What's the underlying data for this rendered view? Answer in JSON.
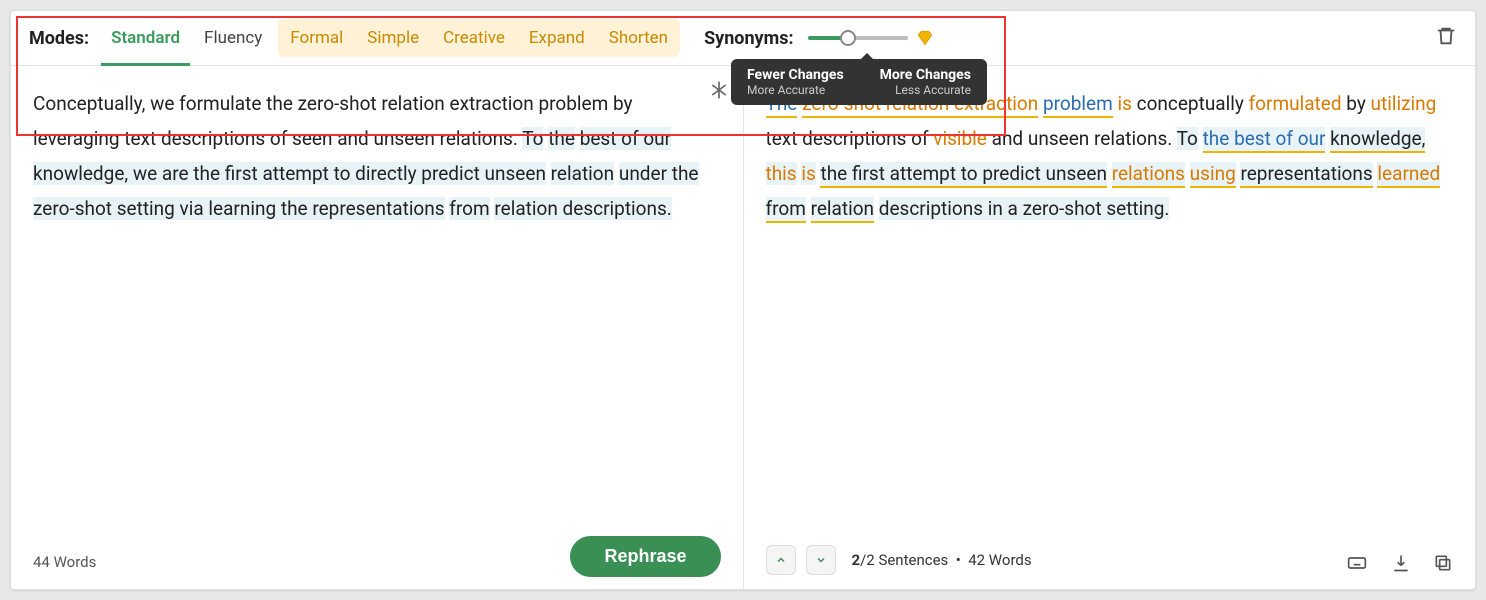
{
  "toolbar": {
    "modes_label": "Modes:",
    "tabs": {
      "standard": "Standard",
      "fluency": "Fluency",
      "formal": "Formal",
      "simple": "Simple",
      "creative": "Creative",
      "expand": "Expand",
      "shorten": "Shorten"
    },
    "active_tab": "standard",
    "synonyms_label": "Synonyms:",
    "slider_value_pct": 40
  },
  "tooltip": {
    "left_title": "Fewer Changes",
    "left_sub": "More Accurate",
    "right_title": "More Changes",
    "right_sub": "Less Accurate"
  },
  "input": {
    "segments": [
      {
        "t": "Conceptually, we formulate the zero-shot relation extraction problem by leveraging text descriptions of seen and unseen relations. "
      },
      {
        "t": "To",
        "cls": "hl-blue"
      },
      {
        "t": " "
      },
      {
        "t": "the",
        "cls": "hl-blue"
      },
      {
        "t": " "
      },
      {
        "t": "best of our knowledge, we are the first attempt to directly predict unseen",
        "cls": "hl-blue"
      },
      {
        "t": " "
      },
      {
        "t": "relation",
        "cls": "hl-blue"
      },
      {
        "t": " "
      },
      {
        "t": "under the zero-shot setting via learning the representations",
        "cls": "hl-blue"
      },
      {
        "t": " "
      },
      {
        "t": "from",
        "cls": "hl-blue"
      },
      {
        "t": " "
      },
      {
        "t": "relation descriptions.",
        "cls": "hl-blue"
      }
    ],
    "word_count_label": "44 Words",
    "rephrase_label": "Rephrase"
  },
  "output": {
    "segments": [
      {
        "t": "The",
        "cls": "txt-blue underline-y"
      },
      {
        "t": " "
      },
      {
        "t": "zero-shot relation extraction",
        "cls": "txt-orange underline-y"
      },
      {
        "t": " "
      },
      {
        "t": "problem",
        "cls": "txt-blue underline-y"
      },
      {
        "t": " "
      },
      {
        "t": "is",
        "cls": "txt-orange"
      },
      {
        "t": " conceptually "
      },
      {
        "t": "formulated",
        "cls": "txt-orange"
      },
      {
        "t": " by "
      },
      {
        "t": "utilizing",
        "cls": "txt-orange"
      },
      {
        "t": " text descriptions of "
      },
      {
        "t": "visible",
        "cls": "txt-orange"
      },
      {
        "t": " and unseen relations. "
      },
      {
        "t": "To",
        "cls": "hl-blue"
      },
      {
        "t": " "
      },
      {
        "t": "the best of our",
        "cls": "hl-blue txt-blue underline-y"
      },
      {
        "t": " "
      },
      {
        "t": "knowledge,",
        "cls": "hl-blue underline-y"
      },
      {
        "t": " "
      },
      {
        "t": "this",
        "cls": "hl-blue txt-orange"
      },
      {
        "t": " "
      },
      {
        "t": "is",
        "cls": "hl-blue txt-orange"
      },
      {
        "t": " "
      },
      {
        "t": "the first attempt to predict unseen",
        "cls": "hl-blue underline-y"
      },
      {
        "t": " "
      },
      {
        "t": "relations",
        "cls": "hl-blue txt-orange underline-y"
      },
      {
        "t": " "
      },
      {
        "t": "using",
        "cls": "hl-blue txt-orange underline-y"
      },
      {
        "t": " "
      },
      {
        "t": "representations",
        "cls": "hl-blue underline-y"
      },
      {
        "t": " "
      },
      {
        "t": "learned",
        "cls": "hl-blue txt-orange underline-y"
      },
      {
        "t": " "
      },
      {
        "t": "from",
        "cls": "hl-blue underline-y"
      },
      {
        "t": " "
      },
      {
        "t": "relation",
        "cls": "hl-blue underline-y"
      },
      {
        "t": " "
      },
      {
        "t": "descriptions in a zero-shot setting.",
        "cls": "hl-blue"
      }
    ],
    "sentence_idx": 2,
    "sentence_total": 2,
    "counts_label": "2/2 Sentences  •  42 Words"
  },
  "colors": {
    "accent_green": "#3a9b5c",
    "premium_bg": "#fff2d6",
    "premium_text": "#c98a00"
  }
}
